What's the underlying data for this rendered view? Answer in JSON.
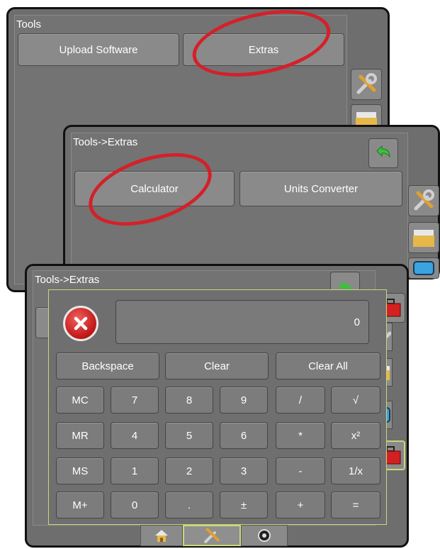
{
  "window1": {
    "title": "Tools",
    "buttons": [
      "Upload Software",
      "Extras"
    ]
  },
  "window2": {
    "title": "Tools->Extras",
    "buttons": [
      "Calculator",
      "Units Converter"
    ]
  },
  "window3": {
    "title": "Tools->Extras"
  },
  "calculator": {
    "display_value": "0",
    "top_row": [
      "Backspace",
      "Clear",
      "Clear All"
    ],
    "rows": [
      [
        "MC",
        "7",
        "8",
        "9",
        "/",
        "√"
      ],
      [
        "MR",
        "4",
        "5",
        "6",
        "*",
        "x²"
      ],
      [
        "MS",
        "1",
        "2",
        "3",
        "-",
        "1/x"
      ],
      [
        "M+",
        "0",
        ".",
        "±",
        "+",
        "="
      ]
    ]
  },
  "colors": {
    "annotation": "#d4202a",
    "panel_border": "#c8d87a",
    "folder": "#e6b84a",
    "toolbox": "#d42020",
    "screen_blue": "#3aa3e0"
  },
  "icons": [
    "tools-icon",
    "data-folder-icon",
    "screen-icon",
    "toolbox-icon",
    "back-arrow-icon",
    "home-icon",
    "settings-icon"
  ]
}
